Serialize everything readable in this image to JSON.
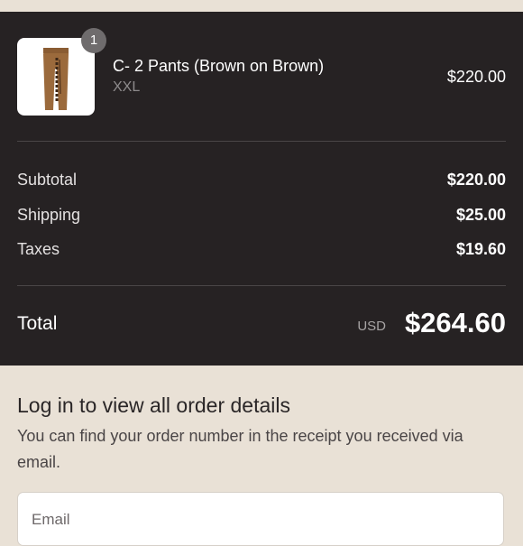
{
  "order_summary": {
    "item": {
      "quantity": "1",
      "name": "C- 2 Pants (Brown on Brown)",
      "variant": "XXL",
      "price": "$220.00",
      "thumbnail_icon": "brown-pants-image"
    },
    "rows": [
      {
        "label": "Subtotal",
        "value": "$220.00"
      },
      {
        "label": "Shipping",
        "value": "$25.00"
      },
      {
        "label": "Taxes",
        "value": "$19.60"
      }
    ],
    "total": {
      "label": "Total",
      "currency": "USD",
      "value": "$264.60"
    }
  },
  "login_prompt": {
    "title": "Log in to view all order details",
    "description": "You can find your order number in the receipt you received via email.",
    "email_field_label": "Email"
  },
  "colors": {
    "summary_background": "#262223",
    "page_background": "#e9e1d6",
    "pants_brown": "#9b6a3c"
  }
}
